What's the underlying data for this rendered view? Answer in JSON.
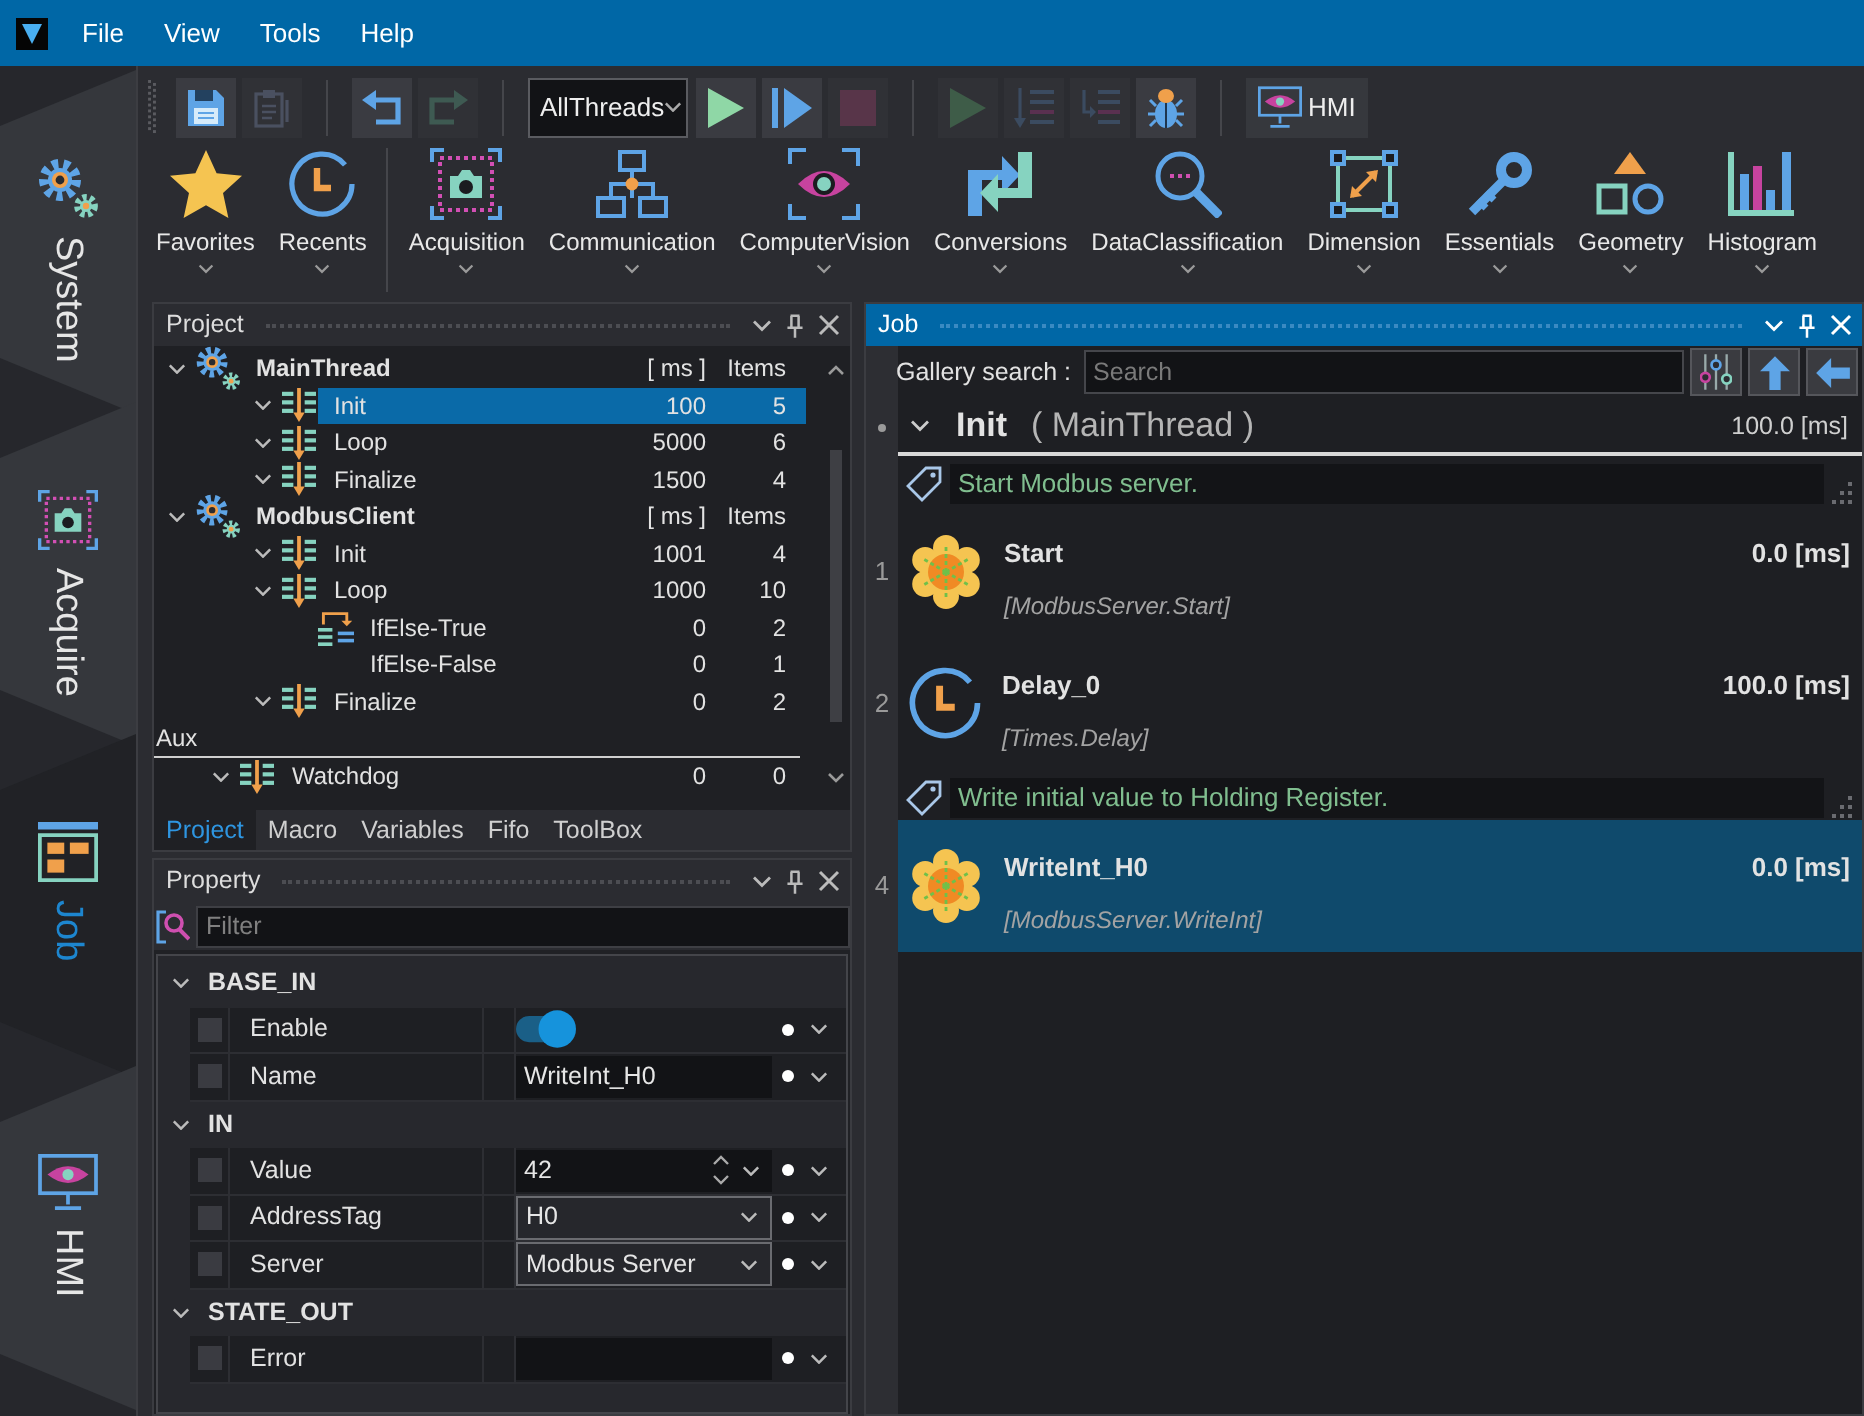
{
  "menu": [
    "File",
    "View",
    "Tools",
    "Help"
  ],
  "sidebar": [
    {
      "label": "System",
      "selected": false
    },
    {
      "label": "Acquire",
      "selected": false
    },
    {
      "label": "Job",
      "selected": true
    },
    {
      "label": "HMI",
      "selected": false
    }
  ],
  "toolbar": {
    "file_buttons": [
      {
        "disabled": false
      },
      {
        "disabled": true
      }
    ],
    "history_buttons": [
      {
        "disabled": false
      },
      {
        "disabled": true
      }
    ],
    "thread_select": "AllThreads",
    "run_buttons": [
      {
        "disabled": false
      },
      {
        "disabled": false
      },
      {
        "disabled": true
      }
    ],
    "debug_buttons": [
      {
        "disabled": true
      },
      {
        "disabled": true
      },
      {
        "disabled": true
      },
      {
        "disabled": false
      }
    ],
    "hmi_button": "HMI"
  },
  "palette": {
    "quick": [
      "Favorites",
      "Recents"
    ],
    "categories": [
      "Acquisition",
      "Communication",
      "ComputerVision",
      "Conversions",
      "DataClassification",
      "Dimension",
      "Essentials",
      "Geometry",
      "Histogram"
    ]
  },
  "project_panel": {
    "title": "Project",
    "threads": [
      {
        "name": "MainThread",
        "ms_header": "[ ms ]",
        "items_header": "Items",
        "expanded": true,
        "selected": false,
        "children": [
          {
            "kind": "sequence",
            "name": "Init",
            "ms": "100",
            "items": "5",
            "expanded": true,
            "selected": true
          },
          {
            "kind": "sequence",
            "name": "Loop",
            "ms": "5000",
            "items": "6",
            "expanded": true,
            "selected": false
          },
          {
            "kind": "sequence",
            "name": "Finalize",
            "ms": "1500",
            "items": "4",
            "expanded": true,
            "selected": false
          }
        ]
      },
      {
        "name": "ModbusClient",
        "ms_header": "[ ms ]",
        "items_header": "Items",
        "expanded": true,
        "selected": false,
        "children": [
          {
            "kind": "sequence",
            "name": "Init",
            "ms": "1001",
            "items": "4",
            "expanded": true,
            "selected": false
          },
          {
            "kind": "sequence",
            "name": "Loop",
            "ms": "1000",
            "items": "10",
            "expanded": true,
            "selected": false,
            "children": [
              {
                "kind": "branch",
                "name": "IfElse-True",
                "ms": "0",
                "items": "2",
                "selected": false
              },
              {
                "kind": "plain",
                "name": "IfElse-False",
                "ms": "0",
                "items": "1",
                "selected": false
              }
            ]
          },
          {
            "kind": "sequence",
            "name": "Finalize",
            "ms": "0",
            "items": "2",
            "expanded": true,
            "selected": false
          }
        ]
      }
    ],
    "aux": {
      "label": "Aux",
      "children": [
        {
          "kind": "sequence",
          "name": "Watchdog",
          "ms": "0",
          "items": "0",
          "expanded": true,
          "selected": false
        }
      ]
    },
    "tabs": [
      {
        "label": "Project",
        "selected": true
      },
      {
        "label": "Macro",
        "selected": false
      },
      {
        "label": "Variables",
        "selected": false
      },
      {
        "label": "Fifo",
        "selected": false
      },
      {
        "label": "ToolBox",
        "selected": false
      }
    ]
  },
  "property_panel": {
    "title": "Property",
    "filter_placeholder": "Filter",
    "groups": [
      {
        "name": "BASE_IN",
        "expanded": true,
        "properties": [
          {
            "kind": "toggle",
            "name": "Enable",
            "checked": false,
            "on": true
          },
          {
            "kind": "text",
            "name": "Name",
            "checked": false,
            "value": "WriteInt_H0"
          }
        ]
      },
      {
        "name": "IN",
        "expanded": true,
        "properties": [
          {
            "kind": "number",
            "name": "Value",
            "checked": false,
            "value": "42"
          },
          {
            "kind": "select",
            "name": "AddressTag",
            "checked": false,
            "value": "H0"
          },
          {
            "kind": "select",
            "name": "Server",
            "checked": false,
            "value": "Modbus Server"
          }
        ]
      },
      {
        "name": "STATE_OUT",
        "expanded": true,
        "properties": [
          {
            "kind": "text",
            "name": "Error",
            "checked": false
          }
        ]
      }
    ]
  },
  "job_panel": {
    "title": "Job",
    "search_label": "Gallery search :",
    "search_placeholder": "Search",
    "section": {
      "name": "Init",
      "thread": "( MainThread )",
      "time": "100.0 [ms]",
      "expanded": true
    },
    "steps": [
      {
        "kind": "comment",
        "text": "Start Modbus server.",
        "selected": false
      },
      {
        "kind": "function",
        "number": "1",
        "name": "Start",
        "path": "[ModbusServer.Start]",
        "time": "0.0 [ms]",
        "selected": false
      },
      {
        "kind": "delay",
        "number": "2",
        "name": "Delay_0",
        "path": "[Times.Delay]",
        "time": "100.0 [ms]",
        "selected": false
      },
      {
        "kind": "comment",
        "text": "Write initial value to Holding Register.",
        "selected": false
      },
      {
        "kind": "function",
        "number": "4",
        "name": "WriteInt_H0",
        "path": "[ModbusServer.WriteInt]",
        "time": "0.0 [ms]",
        "selected": true
      }
    ]
  }
}
